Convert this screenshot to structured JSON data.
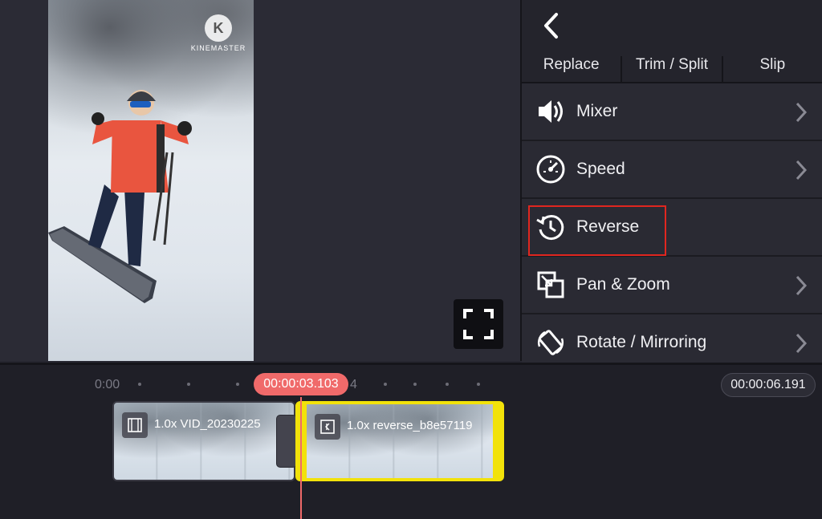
{
  "preview": {
    "watermark": "KINEMASTER",
    "watermark_letter": "K",
    "fullscreen_icon": "fullscreen-icon"
  },
  "panel": {
    "back_icon": "chevron-left-icon",
    "tabs": [
      {
        "label": "Replace"
      },
      {
        "label": "Trim / Split"
      },
      {
        "label": "Slip"
      }
    ],
    "menu": [
      {
        "label": "Mixer",
        "icon": "speaker-icon",
        "has_chevron": true
      },
      {
        "label": "Speed",
        "icon": "speedometer-icon",
        "has_chevron": true
      },
      {
        "label": "Reverse",
        "icon": "reverse-clock-icon",
        "has_chevron": false,
        "highlighted": true
      },
      {
        "label": "Pan & Zoom",
        "icon": "pan-zoom-icon",
        "has_chevron": true
      },
      {
        "label": "Rotate / Mirroring",
        "icon": "rotate-icon",
        "has_chevron": true
      }
    ],
    "highlight_color": "#e0261f"
  },
  "timeline": {
    "ruler_start": "0:00",
    "ruler_partial": "4",
    "playhead_time": "00:00:03.103",
    "total_time": "00:00:06.191",
    "clips": [
      {
        "label": "1.0x VID_20230225",
        "icon": "film-icon",
        "selected": false
      },
      {
        "label": "1.0x reverse_b8e57119",
        "icon": "reverse-film-icon",
        "selected": true
      }
    ],
    "playhead_color": "#f06a6a",
    "selected_clip_color": "#f2e20a"
  }
}
